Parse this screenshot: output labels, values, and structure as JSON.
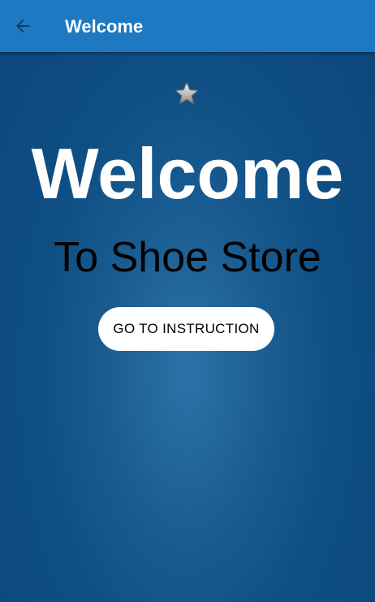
{
  "app_bar": {
    "title": "Welcome",
    "back_icon": "arrow-back-icon",
    "background_color": "#1c79c2"
  },
  "main": {
    "star_icon": "star-icon",
    "heading": "Welcome",
    "subtitle": "To Shoe Store",
    "cta_label": "GO TO INSTRUCTION",
    "background_color": "#1b5e93"
  }
}
